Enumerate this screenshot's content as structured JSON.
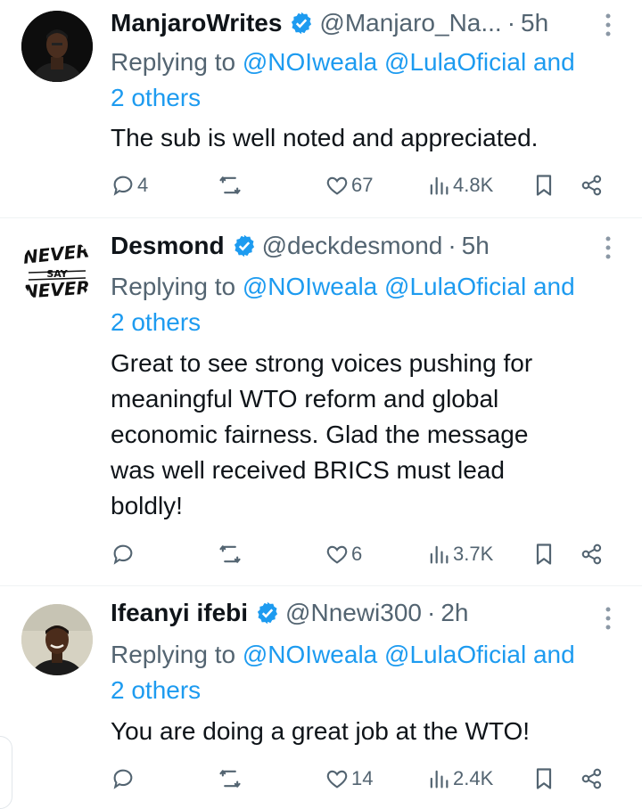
{
  "replies": [
    {
      "name": "ManjaroWrites",
      "handle": "@Manjaro_Na...",
      "dot": "·",
      "time": "5h",
      "replying_prefix": "Replying to ",
      "replying_mentions": "@NOIweala @LulaOficial and",
      "replying_others": "2 others",
      "text": "The sub is well noted and appreciated.",
      "stats": {
        "replies": "4",
        "retweets": "",
        "likes": "67",
        "views": "4.8K"
      }
    },
    {
      "name": "Desmond",
      "handle": "@deckdesmond",
      "dot": "·",
      "time": "5h",
      "replying_prefix": "Replying to ",
      "replying_mentions": "@NOIweala @LulaOficial and",
      "replying_others": "2 others",
      "text_lines": [
        "Great to see strong voices pushing for",
        "meaningful WTO reform and global",
        "economic fairness. Glad the message",
        "was well received BRICS must lead",
        "boldly!"
      ],
      "stats": {
        "replies": "",
        "retweets": "",
        "likes": "6",
        "views": "3.7K"
      }
    },
    {
      "name": "Ifeanyi ifebi",
      "handle": "@Nnewi300",
      "dot": "·",
      "time": "2h",
      "replying_prefix": "Replying to ",
      "replying_mentions": "@NOIweala @LulaOficial and",
      "replying_others": "2 others",
      "text": "You are doing a great job at the WTO!",
      "stats": {
        "replies": "",
        "retweets": "",
        "likes": "14",
        "views": "2.4K"
      }
    }
  ],
  "avatar_texts": {
    "desmond_logo": "NEVER SAY NEVER"
  },
  "icons": [
    "verified-badge-icon",
    "more-icon",
    "reply-icon",
    "retweet-icon",
    "like-icon",
    "views-icon",
    "bookmark-icon",
    "share-icon"
  ],
  "colors": {
    "link": "#1d9bf0",
    "secondary": "#536471",
    "primary_text": "#0f1419",
    "divider": "#eff3f4"
  }
}
